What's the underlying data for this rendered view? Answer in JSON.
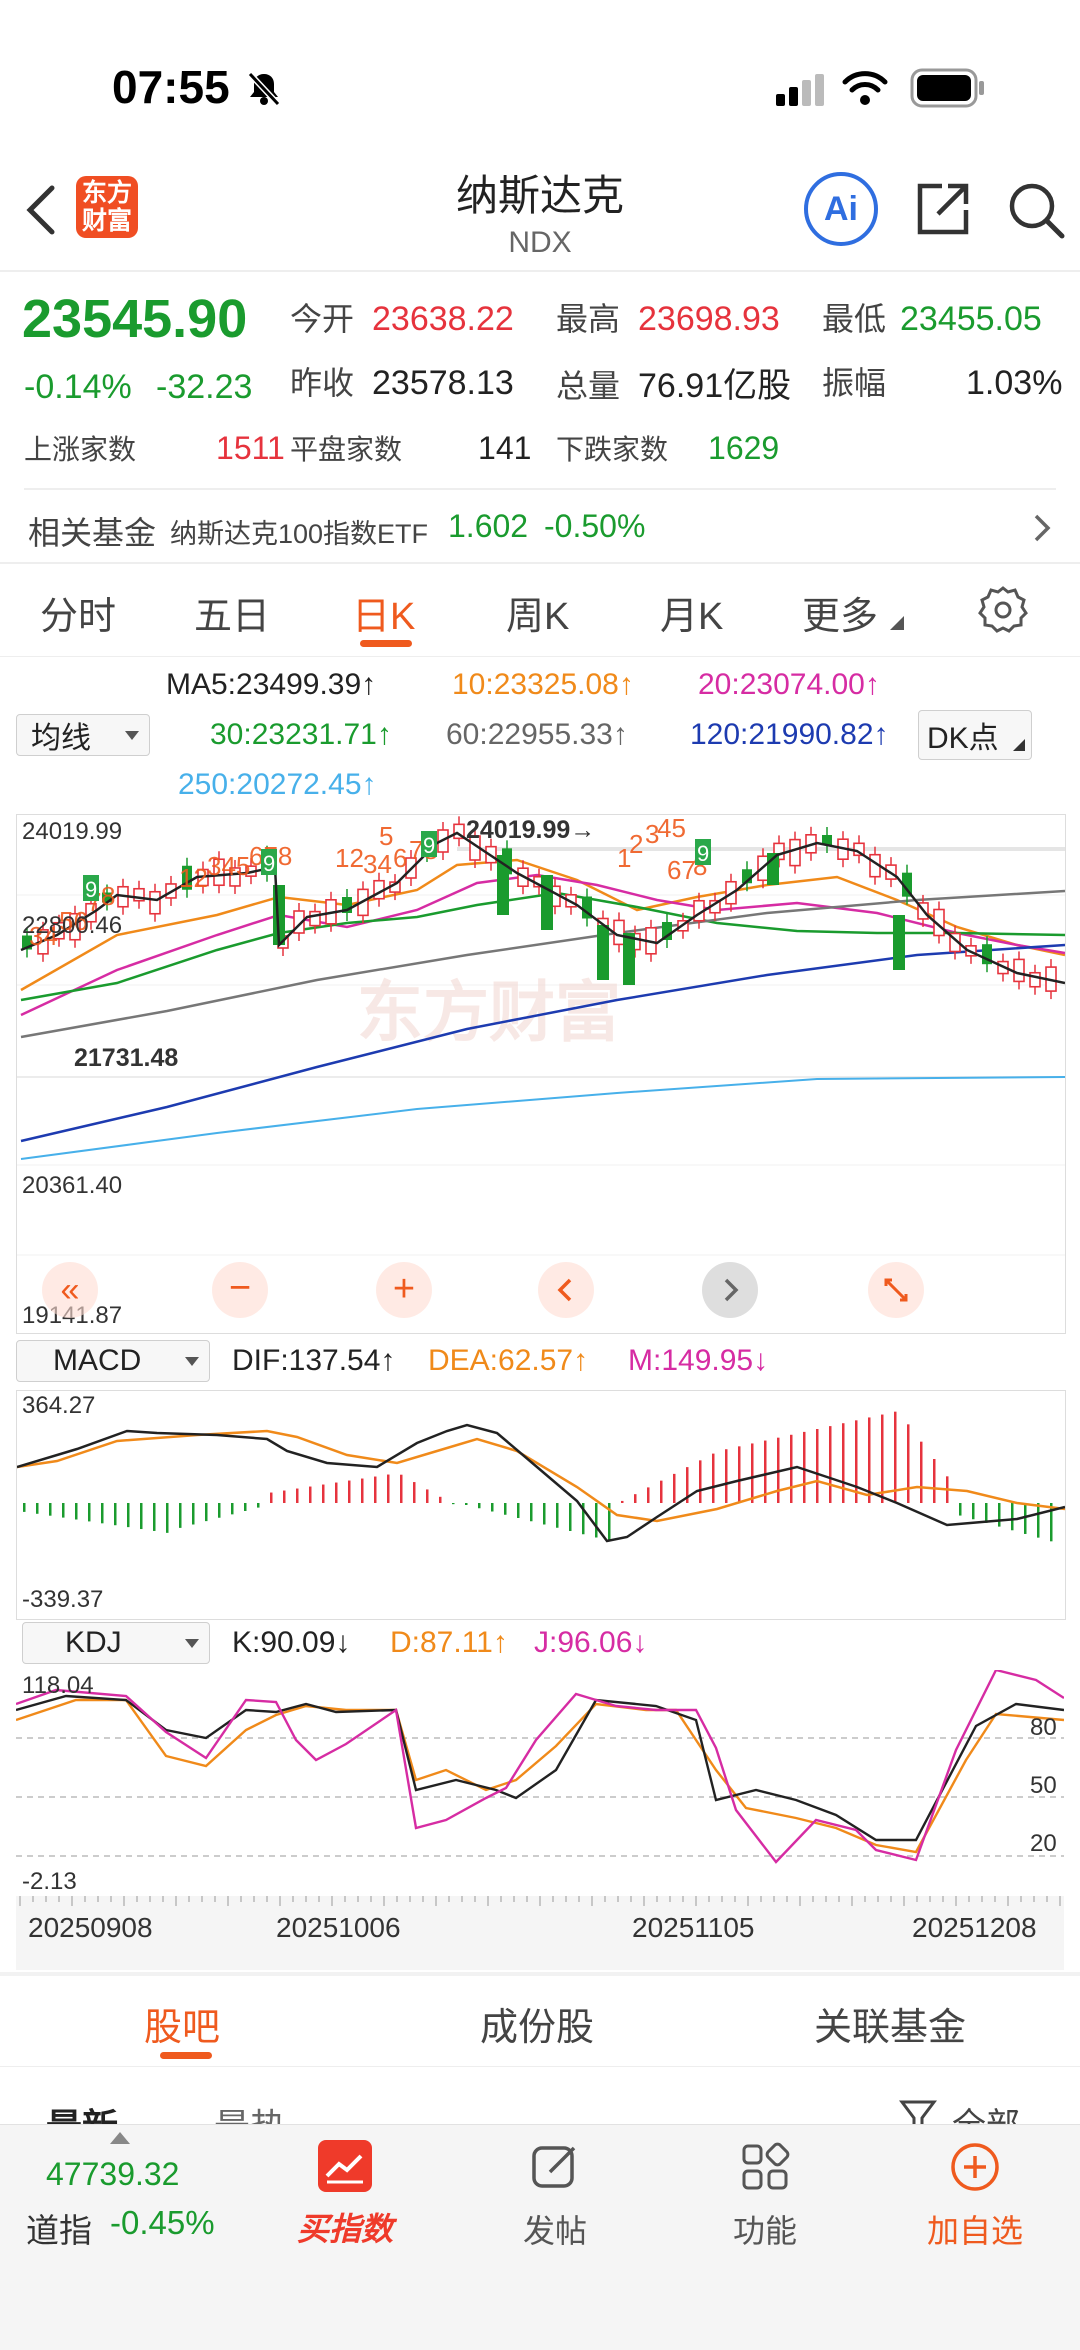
{
  "status_bar": {
    "time": "07:55"
  },
  "header": {
    "logo_text": "东方财富",
    "title": "纳斯达克",
    "code": "NDX",
    "ai_label": "Ai"
  },
  "quote": {
    "price": "23545.90",
    "change_pct": "-0.14%",
    "change": "-32.23",
    "open_label": "今开",
    "open": "23638.22",
    "high_label": "最高",
    "high": "23698.93",
    "low_label": "最低",
    "low": "23455.05",
    "prev_close_label": "昨收",
    "prev_close": "23578.13",
    "volume_label": "总量",
    "volume": "76.91亿股",
    "amplitude_label": "振幅",
    "amplitude": "1.03%",
    "up_label": "上涨家数",
    "up": "1511",
    "flat_label": "平盘家数",
    "flat": "141",
    "down_label": "下跌家数",
    "down": "1629"
  },
  "fund": {
    "label": "相关基金",
    "name": "纳斯达克100指数ETF",
    "price": "1.602",
    "change": "-0.50%"
  },
  "tabs": [
    "分时",
    "五日",
    "日K",
    "周K",
    "月K",
    "更多"
  ],
  "ma": {
    "selector": "均线",
    "ma5": "MA5:23499.39↑",
    "ma10": "10:23325.08↑",
    "ma20": "20:23074.00↑",
    "ma30": "30:23231.71↑",
    "ma60": "60:22955.33↑",
    "ma120": "120:21990.82↑",
    "ma250": "250:20272.45↑",
    "dk": "DK点"
  },
  "kline_axis": {
    "top": "24019.99",
    "mid": "22800.46",
    "low2": "20361.40",
    "bottom": "19141.87",
    "left_marker": "21731.48",
    "max_marker": "24019.99"
  },
  "watermark": "东方财富",
  "macd": {
    "selector": "MACD",
    "dif": "DIF:137.54↑",
    "dea": "DEA:62.57↑",
    "m": "M:149.95↓",
    "top": "364.27",
    "bottom": "-339.37"
  },
  "kdj": {
    "selector": "KDJ",
    "k": "K:90.09↓",
    "d": "D:87.11↑",
    "j": "J:96.06↓",
    "top": "118.04",
    "bottom": "-2.13",
    "l80": "80",
    "l50": "50",
    "l20": "20"
  },
  "dates": [
    "20250908",
    "20251006",
    "20251105",
    "20251208"
  ],
  "bottom_tabs": [
    "股吧",
    "成份股",
    "关联基金"
  ],
  "sub_tabs": {
    "latest": "最新",
    "hot": "最热",
    "all": "全部"
  },
  "toolbar": {
    "dow_value": "47739.32",
    "dow_label": "道指",
    "dow_change": "-0.45%",
    "buy_index": "买指数",
    "post": "发帖",
    "func": "功能",
    "add": "加自选"
  },
  "colors": {
    "up": "#e6333d",
    "down": "#1a9b2e",
    "accent": "#ef5a1e",
    "ma10": "#f08a1a",
    "ma20": "#d62ca3",
    "ma120": "#1d3bb0",
    "ma250": "#47b0ea"
  }
}
